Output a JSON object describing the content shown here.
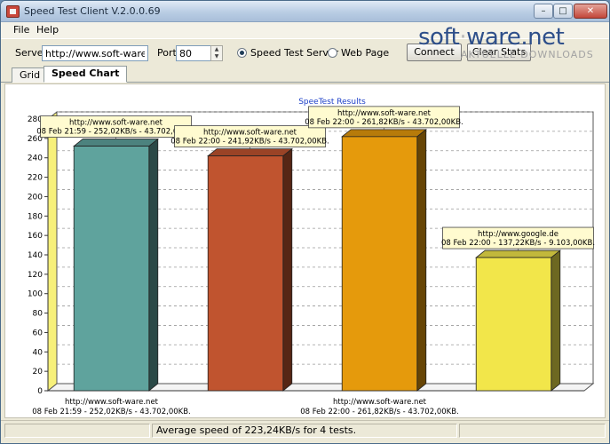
{
  "window": {
    "title": "Speed Test Client V.2.0.0.69",
    "controls": {
      "minimize": "–",
      "maximize": "□",
      "close": "✕"
    }
  },
  "menu": {
    "items": [
      "File",
      "Help"
    ]
  },
  "toolbar": {
    "server_label": "Server",
    "server_value": "http://www.soft-ware.net",
    "port_label": "Port",
    "port_value": "80",
    "radio_speed_label": "Speed Test Server",
    "radio_web_label": "Web Page",
    "radio_selected": "speed",
    "connect_label": "Connect",
    "clear_label": "Clear Stats"
  },
  "watermark": {
    "name_a": "soft",
    "sep": "·",
    "name_b": "ware",
    "name_c": ".net",
    "sub": "AKTUELLE DOWNLOADS"
  },
  "tabs": [
    {
      "label": "Grid",
      "active": false
    },
    {
      "label": "Speed Chart",
      "active": true
    }
  ],
  "status": {
    "text": "Average speed of 223,24KB/s for 4 tests."
  },
  "colors": {
    "bar1": "#5fa39d",
    "bar2": "#c0542f",
    "bar3": "#e59a0c",
    "bar4": "#f2e64a",
    "title": "#1e40c8",
    "grid": "#9a9a9a"
  },
  "chart_data": {
    "type": "bar",
    "title": "SpeeTest Results",
    "ylim": [
      0,
      280
    ],
    "yticks": [
      0,
      20,
      40,
      60,
      80,
      100,
      120,
      140,
      160,
      180,
      200,
      220,
      240,
      260,
      280
    ],
    "grid": true,
    "style": "3d",
    "categories": [
      {
        "line1": "http://www.soft-ware.net",
        "line2": "08 Feb 21:59 - 252,02KB/s - 43.702,00KB."
      },
      {
        "line1": "http://www.soft-ware.net",
        "line2": "08 Feb 22:00 - 241,92KB/s - 43.702,00KB."
      },
      {
        "line1": "http://www.soft-ware.net",
        "line2": "08 Feb 22:00 - 261,82KB/s - 43.702,00KB."
      },
      {
        "line1": "http://www.google.de",
        "line2": "08 Feb 22:00 - 137,22KB/s - 9.103,00KB."
      }
    ],
    "values": [
      252.02,
      241.92,
      261.82,
      137.22
    ],
    "x_labels": [
      {
        "bar": 0,
        "line1": "http://www.soft-ware.net",
        "line2": "08 Feb 21:59 - 252,02KB/s - 43.702,00KB."
      },
      {
        "bar": 2,
        "line1": "http://www.soft-ware.net",
        "line2": "08 Feb 22:00 - 261,82KB/s - 43.702,00KB."
      }
    ]
  }
}
